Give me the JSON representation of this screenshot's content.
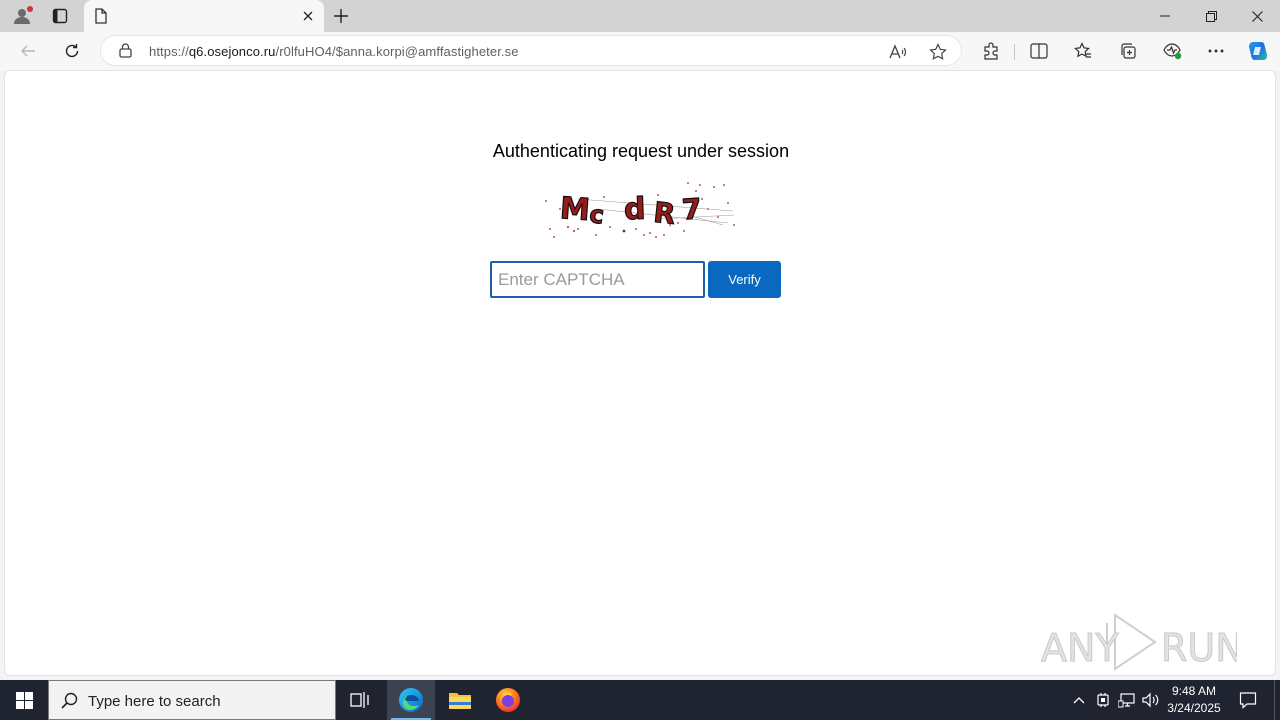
{
  "browser": {
    "tab_title": "",
    "url_host": "q6.osejonco.ru",
    "url_rest": "/r0lfuHO4/$anna.korpi@amffastigheter.se",
    "url_scheme": "https://"
  },
  "page": {
    "heading": "Authenticating request under session",
    "captcha_text": "McdR7",
    "captcha_placeholder": "Enter CAPTCHA",
    "verify_label": "Verify",
    "watermark": "ANY RUN"
  },
  "taskbar": {
    "search_placeholder": "Type here to search",
    "time": "9:48 AM",
    "date": "3/24/2025"
  },
  "colors": {
    "accent": "#0b68c1",
    "input_border": "#1f5fa7",
    "captcha_letters": "#9b1b1b",
    "taskbar": "#1f2430"
  },
  "icons": [
    "profile-icon",
    "tab-actions-icon",
    "page-icon",
    "close-icon",
    "plus-icon",
    "minimize-icon",
    "restore-icon",
    "back-icon",
    "refresh-icon",
    "lock-icon",
    "read-aloud-icon",
    "favorite-star-icon",
    "extensions-icon",
    "split-screen-icon",
    "favorites-icon",
    "collections-icon",
    "performance-icon",
    "more-icon",
    "copilot-icon",
    "windows-start-icon",
    "search-icon",
    "task-view-icon",
    "edge-icon",
    "file-explorer-icon",
    "firefox-icon",
    "chevron-up-icon",
    "network-icon",
    "volume-icon",
    "notification-icon"
  ]
}
